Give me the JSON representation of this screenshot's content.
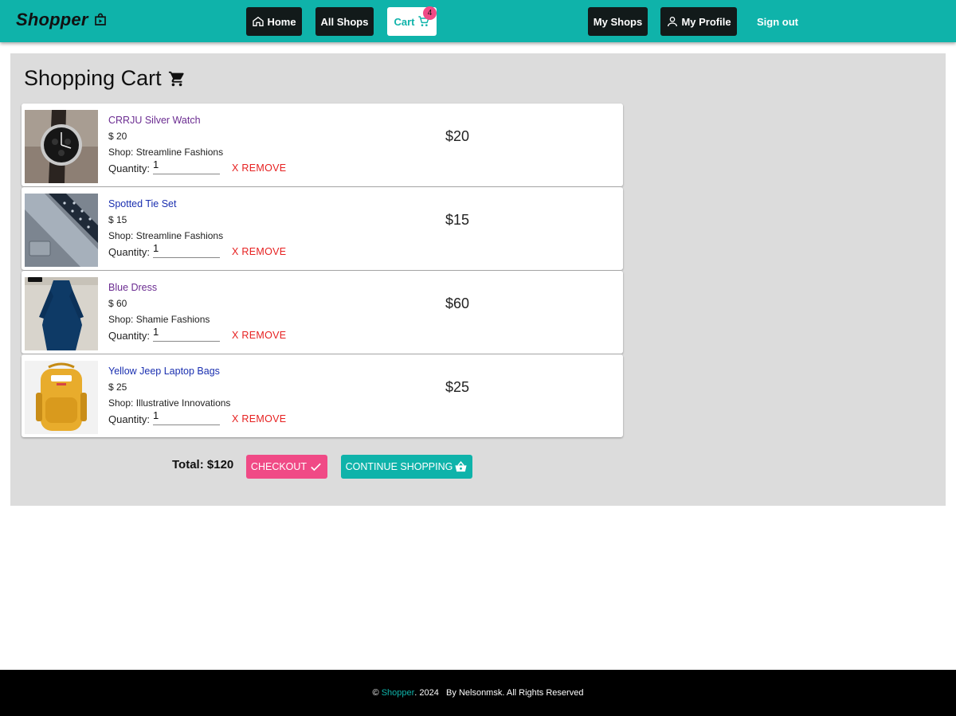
{
  "header": {
    "brand": "Shopper",
    "nav": {
      "home": "Home",
      "all_shops": "All Shops",
      "cart": "Cart",
      "cart_count": "4",
      "my_shops": "My Shops",
      "my_profile": "My Profile",
      "sign_out": "Sign out"
    }
  },
  "cart": {
    "title": "Shopping Cart",
    "qty_label": "Quantity:",
    "remove_label": "X REMOVE",
    "items": [
      {
        "name": "CRRJU Silver Watch",
        "price": "$ 20",
        "shop": "Shop: Streamline Fashions",
        "quantity": "1",
        "line_total": "$20",
        "image": "watch"
      },
      {
        "name": "Spotted Tie Set",
        "price": "$ 15",
        "shop": "Shop: Streamline Fashions",
        "quantity": "1",
        "line_total": "$15",
        "image": "tie"
      },
      {
        "name": "Blue Dress",
        "price": "$ 60",
        "shop": "Shop: Shamie Fashions",
        "quantity": "1",
        "line_total": "$60",
        "image": "dress"
      },
      {
        "name": "Yellow Jeep Laptop Bags",
        "price": "$ 25",
        "shop": "Shop: Illustrative Innovations",
        "quantity": "1",
        "line_total": "$25",
        "image": "backpack"
      }
    ],
    "total": "Total: $120",
    "checkout_label": "CHECKOUT",
    "continue_label": "CONTINUE SHOPPING"
  },
  "footer": {
    "copyright": "©",
    "brand": "Shopper",
    "rest": ". 2024   By Nelsonmsk. All Rights Reserved"
  },
  "colors": {
    "primary": "#0fb3aa",
    "accent": "#f04a86",
    "danger": "#e62020",
    "dark": "#121a1a"
  }
}
